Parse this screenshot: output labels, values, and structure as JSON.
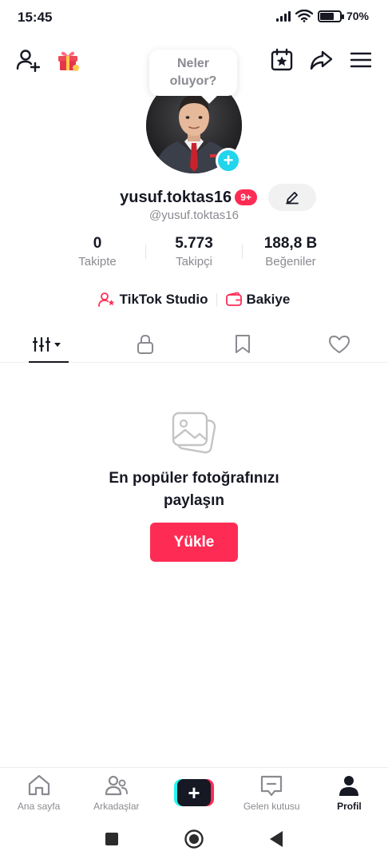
{
  "status_bar": {
    "time": "15:45",
    "battery": "70%"
  },
  "speech_bubble": {
    "line1": "Neler",
    "line2": "oluyor?"
  },
  "profile": {
    "username": "yusuf.toktas16",
    "badge": "9+",
    "handle": "@yusuf.toktas16"
  },
  "stats": [
    {
      "value": "0",
      "label": "Takipte"
    },
    {
      "value": "5.773",
      "label": "Takipçi"
    },
    {
      "value": "188,8 B",
      "label": "Beğeniler"
    }
  ],
  "links": {
    "studio": "TikTok Studio",
    "balance": "Bakiye"
  },
  "empty_state": {
    "title_line1": "En popüler fotoğrafınızı",
    "title_line2": "paylaşın",
    "button": "Yükle"
  },
  "bottom_nav": {
    "home": "Ana sayfa",
    "friends": "Arkadaşlar",
    "inbox": "Gelen kutusu",
    "profile": "Profil"
  },
  "colors": {
    "accent": "#fe2c55",
    "cyan": "#25f4ee",
    "text": "#161823",
    "muted": "#8a8b91"
  }
}
